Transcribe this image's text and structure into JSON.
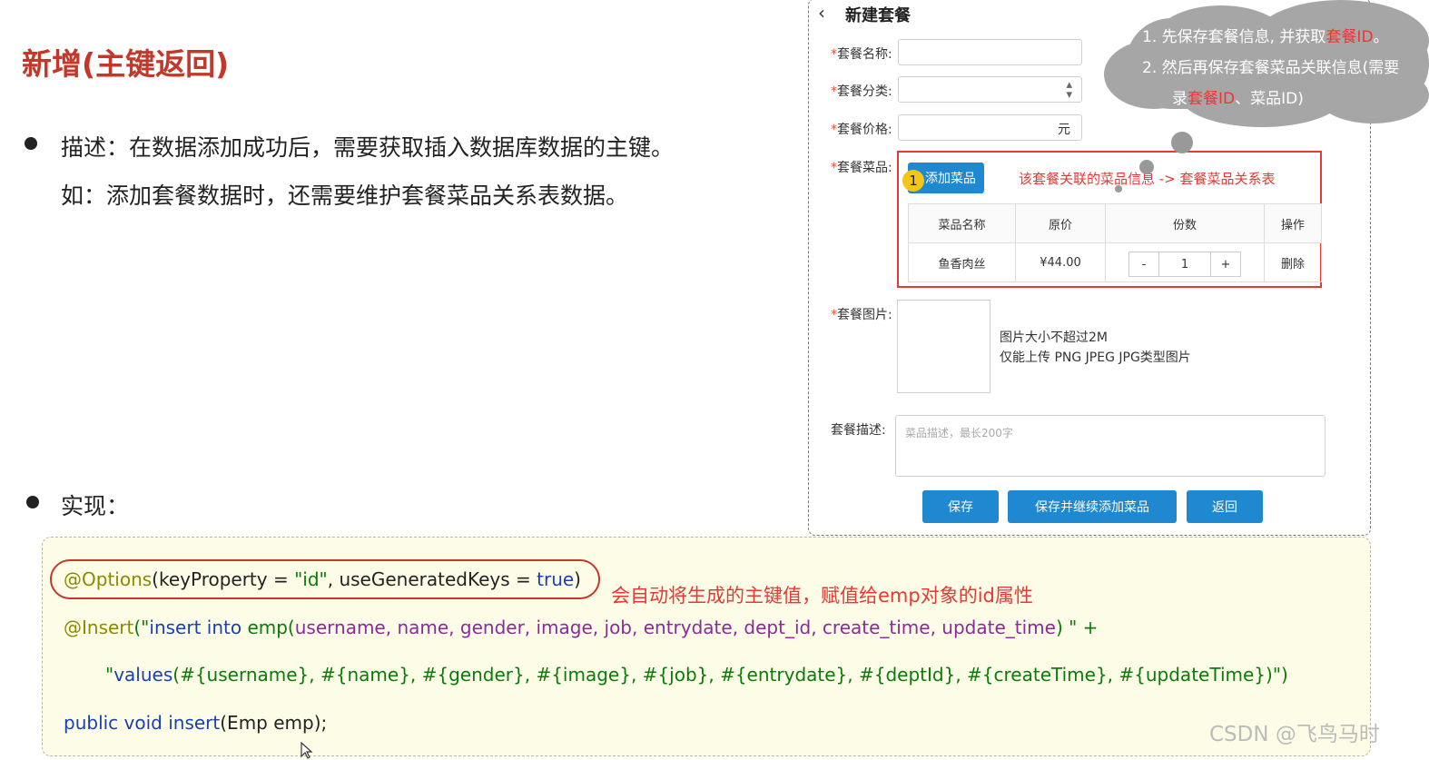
{
  "title": "新增(主键返回)",
  "description": {
    "line1": "描述：在数据添加成功后，需要获取插入数据库数据的主键。",
    "line2": "如：添加套餐数据时，还需要维护套餐菜品关系表数据。"
  },
  "implementation_label": "实现：",
  "dialog": {
    "back_icon": "chevron-left-icon",
    "title": "新建套餐",
    "required_mark": "*",
    "name_label": "套餐名称:",
    "category_label": "套餐分类:",
    "price_label": "套餐价格:",
    "price_unit": "元",
    "dishes_label": "套餐菜品:",
    "add_dish_button": "添加菜品",
    "step_badge": "1",
    "dish_note": "该套餐关联的菜品信息  ->  套餐菜品关系表",
    "table": {
      "headers": [
        "菜品名称",
        "原价",
        "份数",
        "操作"
      ],
      "rows": [
        {
          "name": "鱼香肉丝",
          "price": "¥44.00",
          "minus": "-",
          "qty": "1",
          "plus": "+",
          "action": "删除"
        }
      ]
    },
    "image_label": "套餐图片:",
    "image_hint1": "图片大小不超过2M",
    "image_hint2": "仅能上传 PNG JPEG JPG类型图片",
    "desc_label": "套餐描述:",
    "desc_placeholder": "菜品描述，最长200字",
    "buttons": {
      "save": "保存",
      "save_continue": "保存并继续添加菜品",
      "back": "返回"
    }
  },
  "cloud": {
    "line1_prefix": "1.   先保存套餐信息, 并获取",
    "line1_hl": "套餐ID",
    "line1_suffix": "。",
    "line2": "2.   然后再保存套餐菜品关联信息(需要",
    "line3_prefix": "录",
    "line3_hl": "套餐ID",
    "line3_suffix": "、菜品ID)"
  },
  "code": {
    "l1_ann": "@Options",
    "l1_a": "(keyProperty = ",
    "l1_s1": "\"id\"",
    "l1_b": ", useGeneratedKeys = ",
    "l1_kw": "true",
    "l1_c": ")",
    "l2_ann": "@Insert",
    "l2_a": "(\"",
    "l2_kw": "insert into",
    "l2_b": " emp(",
    "l2_cols": "username, name, gender, image, job, entrydate, dept_id, create_time, update_time",
    "l2_c": ") \" +",
    "l3_a": "\"",
    "l3_kw": "values",
    "l3_b": "(",
    "l3_vals": "#{username}, #{name}, #{gender}, #{image}, #{job}, #{entrydate}, #{deptId}, #{createTime}, #{updateTime}",
    "l3_c": ")\")",
    "l4_kw": "public void",
    "l4_m": " insert",
    "l4_a": "(Emp emp);",
    "note": "会自动将生成的主键值，赋值给emp对象的id属性"
  },
  "watermark": "CSDN @飞鸟马时"
}
